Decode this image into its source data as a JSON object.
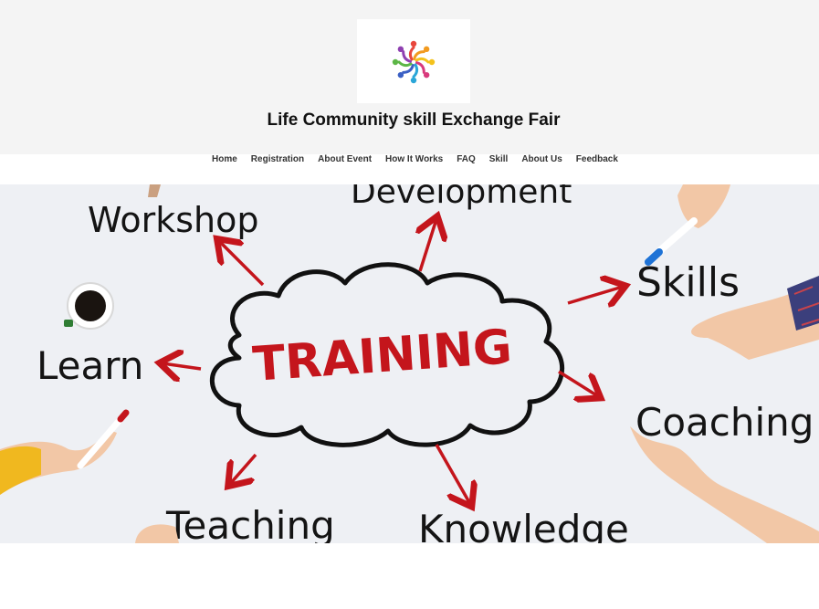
{
  "site": {
    "title": "Life Community skill Exchange Fair",
    "logo_icon": "community-people-circle-logo"
  },
  "nav": {
    "items": [
      {
        "label": "Home"
      },
      {
        "label": "Registration"
      },
      {
        "label": "About Event"
      },
      {
        "label": "How It Works"
      },
      {
        "label": "FAQ"
      },
      {
        "label": "Skill"
      },
      {
        "label": "About Us"
      },
      {
        "label": "Feedback"
      }
    ]
  },
  "hero": {
    "center_word": "TRAINING",
    "words": {
      "workshop": "Workshop",
      "development": "Development",
      "skills": "Skills",
      "learn": "Learn",
      "coaching": "Coaching",
      "teaching": "Teaching",
      "knowledge": "Knowledge"
    }
  },
  "colors": {
    "header_bg": "#f4f4f4",
    "hero_bg": "#eef0f4",
    "accent_red": "#c4151c",
    "text": "#111111"
  }
}
